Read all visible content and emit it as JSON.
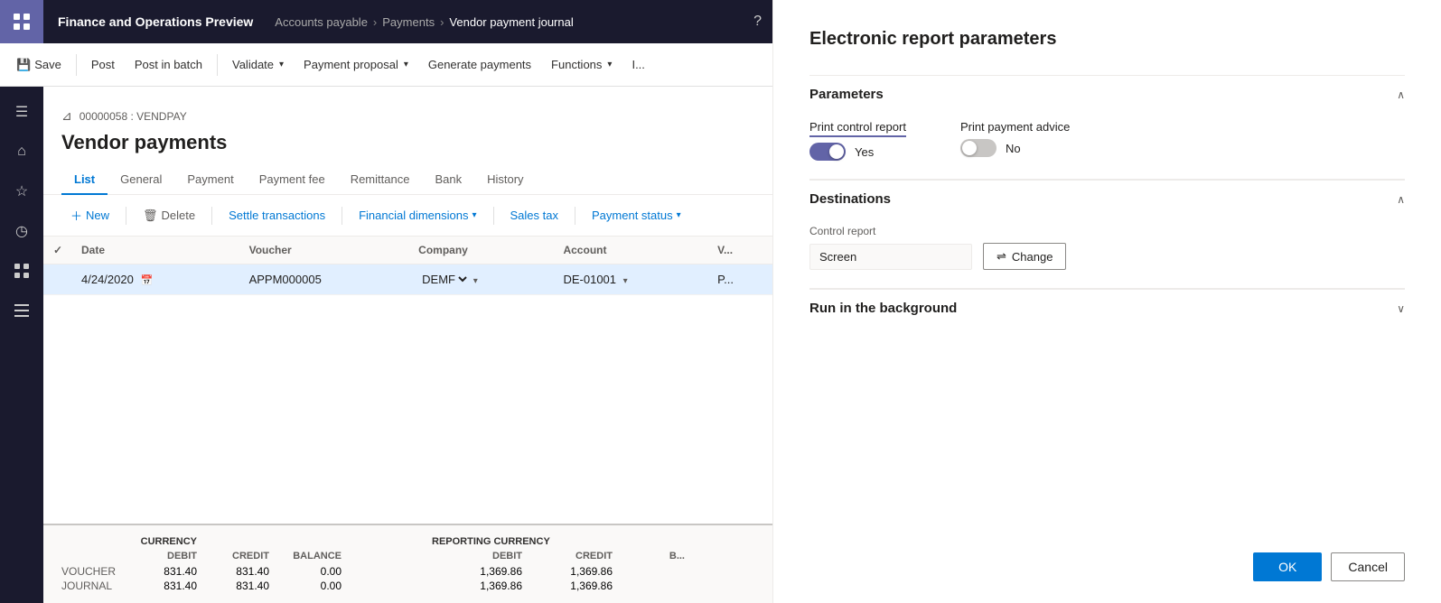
{
  "app": {
    "title": "Finance and Operations Preview",
    "grid_icon": "⊞"
  },
  "breadcrumb": {
    "items": [
      "Accounts payable",
      "Payments",
      "Vendor payment journal"
    ]
  },
  "toolbar": {
    "save_label": "Save",
    "post_label": "Post",
    "post_batch_label": "Post in batch",
    "validate_label": "Validate",
    "payment_proposal_label": "Payment proposal",
    "generate_payments_label": "Generate payments",
    "functions_label": "Functions",
    "inquiry_label": "I..."
  },
  "journal": {
    "id": "00000058 : VENDPAY",
    "title": "Vendor payments"
  },
  "tabs": [
    {
      "label": "List",
      "active": true
    },
    {
      "label": "General",
      "active": false
    },
    {
      "label": "Payment",
      "active": false
    },
    {
      "label": "Payment fee",
      "active": false
    },
    {
      "label": "Remittance",
      "active": false
    },
    {
      "label": "Bank",
      "active": false
    },
    {
      "label": "History",
      "active": false
    }
  ],
  "actions": {
    "new_label": "New",
    "delete_label": "Delete",
    "settle_label": "Settle transactions",
    "fin_dim_label": "Financial dimensions",
    "sales_tax_label": "Sales tax",
    "payment_status_label": "Payment status"
  },
  "table": {
    "columns": [
      "",
      "Date",
      "Voucher",
      "Company",
      "Account",
      "V..."
    ],
    "rows": [
      {
        "checked": false,
        "date": "4/24/2020",
        "voucher": "APPM000005",
        "company": "DEMF",
        "account": "DE-01001",
        "v": "P..."
      }
    ]
  },
  "summary": {
    "currency_label": "CURRENCY",
    "reporting_label": "REPORTING CURRENCY",
    "debit_label": "DEBIT",
    "credit_label": "CREDIT",
    "balance_label": "BALANCE",
    "rows": [
      {
        "label": "VOUCHER",
        "debit": "831.40",
        "credit": "831.40",
        "balance": "0.00",
        "rep_debit": "1,369.86",
        "rep_credit": "1,369.86"
      },
      {
        "label": "JOURNAL",
        "debit": "831.40",
        "credit": "831.40",
        "balance": "0.00",
        "rep_debit": "1,369.86",
        "rep_credit": "1,369.86"
      }
    ]
  },
  "right_panel": {
    "title": "Electronic report parameters",
    "parameters_section": {
      "label": "Parameters",
      "print_control_report": {
        "label": "Print control report",
        "value": true,
        "value_label": "Yes"
      },
      "print_payment_advice": {
        "label": "Print payment advice",
        "value": false,
        "value_label": "No"
      }
    },
    "destinations_section": {
      "label": "Destinations",
      "control_report_label": "Control report",
      "screen_value": "Screen",
      "change_btn_label": "Change"
    },
    "run_background_section": {
      "label": "Run in the background"
    },
    "ok_label": "OK",
    "cancel_label": "Cancel"
  },
  "sidebar": {
    "icons": [
      {
        "name": "hamburger",
        "symbol": "☰"
      },
      {
        "name": "home",
        "symbol": "⌂"
      },
      {
        "name": "star",
        "symbol": "☆"
      },
      {
        "name": "clock",
        "symbol": "◷"
      },
      {
        "name": "grid",
        "symbol": "⊞"
      },
      {
        "name": "list",
        "symbol": "☰"
      }
    ]
  }
}
